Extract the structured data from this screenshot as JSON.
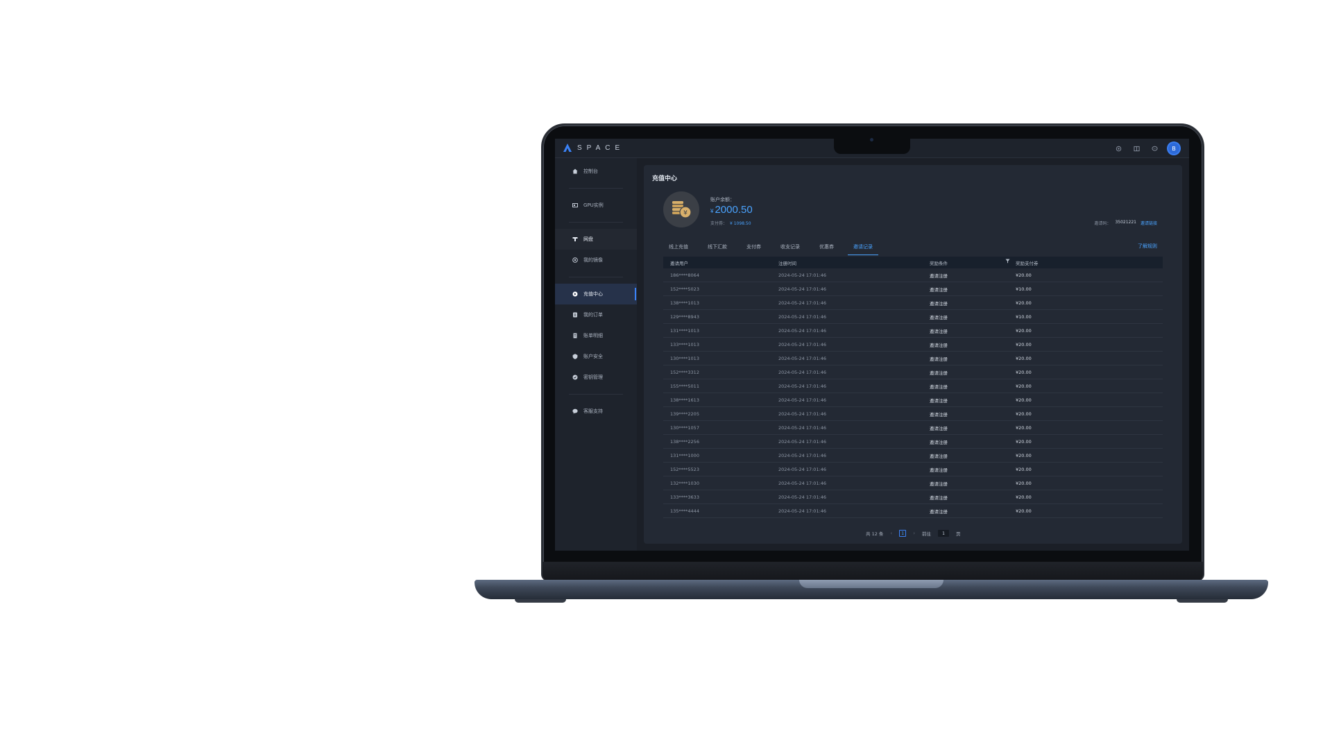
{
  "app": {
    "logo_text": "SPACE",
    "brand_color": "#3b82f6",
    "avatar_initial": "B"
  },
  "topbar": {
    "icons": [
      "settings-icon",
      "book-icon",
      "message-icon"
    ]
  },
  "sidebar": {
    "items": [
      {
        "label": "控制台",
        "icon": "home-icon"
      },
      {
        "label": "GPU实例",
        "icon": "gpu-icon"
      },
      {
        "label": "网盘",
        "icon": "disk-icon"
      },
      {
        "label": "我的镜像",
        "icon": "image-icon"
      },
      {
        "label": "充值中心",
        "icon": "recharge-icon",
        "active": true
      },
      {
        "label": "我的订单",
        "icon": "order-icon"
      },
      {
        "label": "账单明细",
        "icon": "bill-icon"
      },
      {
        "label": "账户安全",
        "icon": "security-icon"
      },
      {
        "label": "密钥管理",
        "icon": "key-icon"
      },
      {
        "label": "客服支持",
        "icon": "support-icon"
      }
    ]
  },
  "main": {
    "title": "充值中心",
    "balance_label": "账户余额：",
    "currency_symbol": "¥",
    "balance_value": "2000.50",
    "coupon_label": "支付券：",
    "coupon_value": "¥ 1098.50",
    "invite_code_label": "邀请码：",
    "invite_code": "35021221",
    "invite_link_label": "邀请链接",
    "help_link": "了解规则",
    "tabs": [
      {
        "label": "线上充值"
      },
      {
        "label": "线下汇款"
      },
      {
        "label": "支付券"
      },
      {
        "label": "收支记录"
      },
      {
        "label": "优惠券"
      },
      {
        "label": "邀请记录",
        "active": true
      }
    ]
  },
  "table": {
    "headers": [
      "邀请用户",
      "注册时间",
      "奖励条件",
      "奖励支付券"
    ],
    "rows": [
      [
        "186****8064",
        "2024-05-24 17:01:46",
        "邀请注册",
        "¥20.00"
      ],
      [
        "152****5023",
        "2024-05-24 17:01:46",
        "邀请注册",
        "¥10.00"
      ],
      [
        "138****1013",
        "2024-05-24 17:01:46",
        "邀请注册",
        "¥20.00"
      ],
      [
        "129****8943",
        "2024-05-24 17:01:46",
        "邀请注册",
        "¥10.00"
      ],
      [
        "131****1013",
        "2024-05-24 17:01:46",
        "邀请注册",
        "¥20.00"
      ],
      [
        "133****1013",
        "2024-05-24 17:01:46",
        "邀请注册",
        "¥20.00"
      ],
      [
        "130****1013",
        "2024-05-24 17:01:46",
        "邀请注册",
        "¥20.00"
      ],
      [
        "152****3312",
        "2024-05-24 17:01:46",
        "邀请注册",
        "¥20.00"
      ],
      [
        "155****5011",
        "2024-05-24 17:01:46",
        "邀请注册",
        "¥20.00"
      ],
      [
        "138****1613",
        "2024-05-24 17:01:46",
        "邀请注册",
        "¥20.00"
      ],
      [
        "139****2205",
        "2024-05-24 17:01:46",
        "邀请注册",
        "¥20.00"
      ],
      [
        "130****1057",
        "2024-05-24 17:01:46",
        "邀请注册",
        "¥20.00"
      ],
      [
        "138****2256",
        "2024-05-24 17:01:46",
        "邀请注册",
        "¥20.00"
      ],
      [
        "131****1000",
        "2024-05-24 17:01:46",
        "邀请注册",
        "¥20.00"
      ],
      [
        "152****5523",
        "2024-05-24 17:01:46",
        "邀请注册",
        "¥20.00"
      ],
      [
        "132****1030",
        "2024-05-24 17:01:46",
        "邀请注册",
        "¥20.00"
      ],
      [
        "133****3633",
        "2024-05-24 17:01:46",
        "邀请注册",
        "¥20.00"
      ],
      [
        "135****4444",
        "2024-05-24 17:01:46",
        "邀请注册",
        "¥20.00"
      ]
    ]
  },
  "pager": {
    "total": "共 12 条",
    "prev": "‹",
    "next": "›",
    "current_page": "1",
    "goto_label": "前往",
    "goto_value": "1",
    "page_unit": "页"
  }
}
